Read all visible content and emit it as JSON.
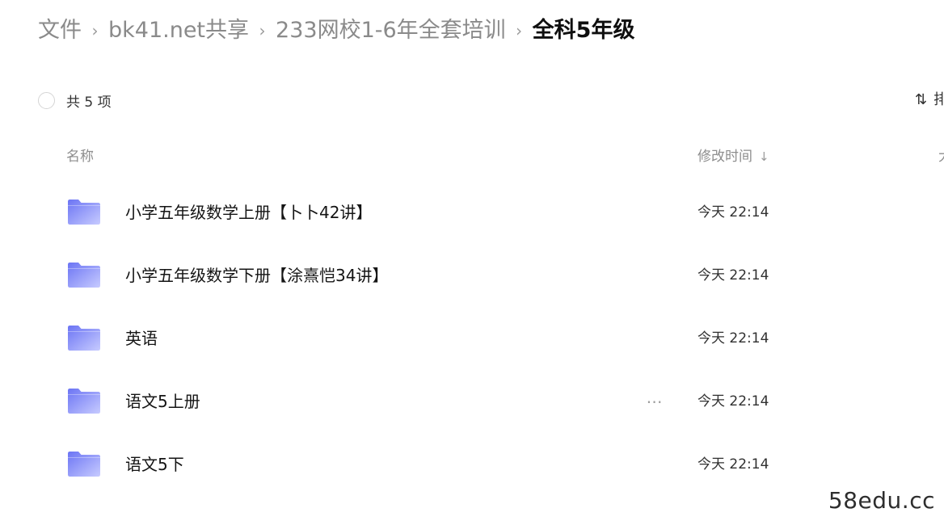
{
  "breadcrumb": {
    "items": [
      {
        "label": "文件"
      },
      {
        "label": "bk41.net共享"
      },
      {
        "label": "233网校1-6年全套培训"
      },
      {
        "label": "全科5年级"
      }
    ],
    "separator": "›"
  },
  "summary": {
    "count_label": "共 5 项"
  },
  "sort": {
    "glyph": "⇅",
    "label": "排"
  },
  "columns": {
    "name": "名称",
    "modified": "修改时间",
    "sort_arrow": "↓",
    "size": "大"
  },
  "files": [
    {
      "name": "小学五年级数学上册【卜卜42讲】",
      "modified": "今天 22:14"
    },
    {
      "name": "小学五年级数学下册【涂熹恺34讲】",
      "modified": "今天 22:14"
    },
    {
      "name": "英语",
      "modified": "今天 22:14"
    },
    {
      "name": "语文5上册",
      "modified": "今天 22:14",
      "more": "⋯"
    },
    {
      "name": "语文5下",
      "modified": "今天 22:14"
    }
  ],
  "watermark": "58edu.cc",
  "colors": {
    "folder_gradient_top": "#6b74f4",
    "folder_gradient_bottom": "#c7cbff",
    "breadcrumb_muted": "#8a8a8a",
    "breadcrumb_current": "#0f0f0f"
  },
  "icons": {
    "folder": "folder-icon",
    "more": "more-horizontal-icon",
    "sort": "sort-icon",
    "select": "select-all-circle-icon"
  }
}
